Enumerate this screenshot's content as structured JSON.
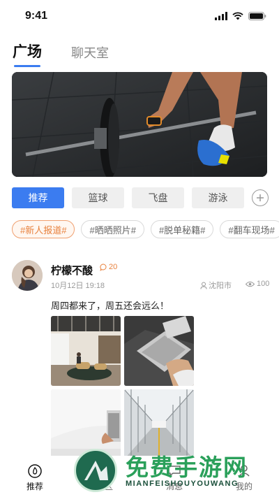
{
  "status_bar": {
    "time": "9:41"
  },
  "tabs": [
    {
      "label": "广场",
      "active": true
    },
    {
      "label": "聊天室",
      "active": false
    }
  ],
  "categories": [
    {
      "label": "推荐",
      "active": true
    },
    {
      "label": "篮球",
      "active": false
    },
    {
      "label": "飞盘",
      "active": false
    },
    {
      "label": "游泳",
      "active": false
    }
  ],
  "topic_tags": [
    {
      "label": "#新人报道#",
      "active": true
    },
    {
      "label": "#晒晒照片#",
      "active": false
    },
    {
      "label": "#脱单秘籍#",
      "active": false
    },
    {
      "label": "#翻车现场#",
      "active": false
    }
  ],
  "post": {
    "author": "柠檬不酸",
    "comment_count": "20",
    "date": "10月12日 19:18",
    "location": "沈阳市",
    "views": "100",
    "text": "周四都来了，周五还会远么！"
  },
  "bottom_nav": [
    {
      "label": "推荐",
      "active": true
    },
    {
      "label": "社区",
      "active": false
    },
    {
      "label": "消息",
      "active": false
    },
    {
      "label": "我的",
      "active": false
    }
  ],
  "watermark": {
    "title": "免费手游网",
    "subtitle": "MIANFEISHOUYOUWANG"
  },
  "colors": {
    "accent": "#3b7cf0",
    "tag_orange": "#e8813d",
    "watermark_green": "#2aa05a"
  }
}
